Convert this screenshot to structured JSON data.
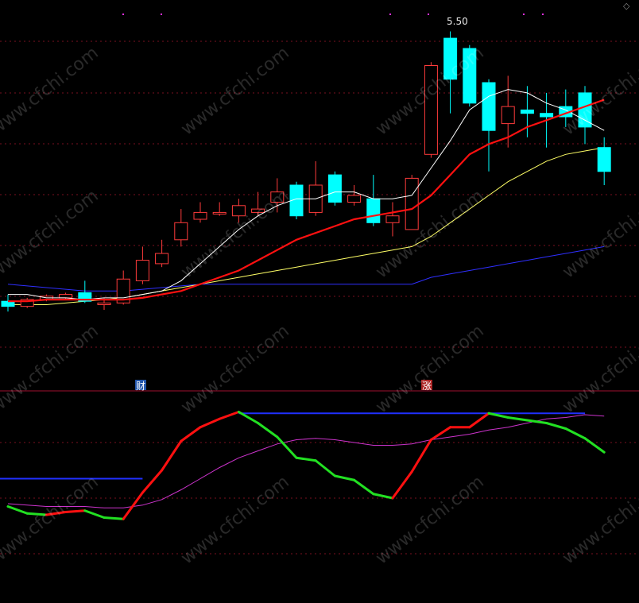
{
  "chart_data": [
    {
      "type": "candlestick",
      "panel": "price",
      "high_label": "5.50",
      "colors": {
        "up": "#ff3b3b",
        "down": "#00ffff",
        "ma5": "#ffffff",
        "ma10": "#ff1010",
        "ma20": "#ffff66",
        "ma60": "#2f2fff"
      },
      "candles": [
        {
          "o": 11,
          "c": 9.5,
          "h": 13,
          "l": 8
        },
        {
          "o": 9.5,
          "c": 11.5,
          "h": 12,
          "l": 9
        },
        {
          "o": 11.5,
          "c": 12.5,
          "h": 13,
          "l": 11
        },
        {
          "o": 12,
          "c": 13,
          "h": 13.5,
          "l": 11.5
        },
        {
          "o": 13.5,
          "c": 11,
          "h": 17,
          "l": 10.5
        },
        {
          "o": 10,
          "c": 10.5,
          "h": 12,
          "l": 8.5
        },
        {
          "o": 10.5,
          "c": 17.5,
          "h": 20,
          "l": 10
        },
        {
          "o": 17,
          "c": 23,
          "h": 27,
          "l": 16
        },
        {
          "o": 22,
          "c": 25,
          "h": 29,
          "l": 21
        },
        {
          "o": 29,
          "c": 34,
          "h": 38,
          "l": 27
        },
        {
          "o": 35,
          "c": 37,
          "h": 40,
          "l": 34
        },
        {
          "o": 37,
          "c": 37,
          "h": 40,
          "l": 36
        },
        {
          "o": 36,
          "c": 39,
          "h": 41,
          "l": 34
        },
        {
          "o": 37,
          "c": 38,
          "h": 43,
          "l": 36
        },
        {
          "o": 40,
          "c": 43,
          "h": 47,
          "l": 37
        },
        {
          "o": 45,
          "c": 36,
          "h": 46,
          "l": 35
        },
        {
          "o": 37,
          "c": 45,
          "h": 52,
          "l": 36
        },
        {
          "o": 48,
          "c": 40,
          "h": 49,
          "l": 39
        },
        {
          "o": 40,
          "c": 42,
          "h": 45,
          "l": 39
        },
        {
          "o": 41,
          "c": 34,
          "h": 48,
          "l": 33
        },
        {
          "o": 34,
          "c": 36,
          "h": 40,
          "l": 30
        },
        {
          "o": 32,
          "c": 47,
          "h": 48,
          "l": 32
        },
        {
          "o": 54,
          "c": 80,
          "h": 81,
          "l": 53
        },
        {
          "o": 88,
          "c": 76,
          "h": 90,
          "l": 66
        },
        {
          "o": 85,
          "c": 69,
          "h": 86,
          "l": 68
        },
        {
          "o": 75,
          "c": 61,
          "h": 76,
          "l": 49
        },
        {
          "o": 63,
          "c": 68,
          "h": 77,
          "l": 56
        },
        {
          "o": 67,
          "c": 66,
          "h": 74,
          "l": 59
        },
        {
          "o": 66,
          "c": 65,
          "h": 72,
          "l": 56
        },
        {
          "o": 68,
          "c": 65,
          "h": 73,
          "l": 62
        },
        {
          "o": 72,
          "c": 62,
          "h": 74,
          "l": 57
        },
        {
          "o": 56,
          "c": 49,
          "h": 59,
          "l": 45
        }
      ],
      "ma5": [
        13,
        13,
        12,
        12,
        11.5,
        12,
        12,
        13,
        14,
        17,
        22,
        27,
        32,
        36,
        39,
        41,
        41,
        43,
        43,
        41,
        41,
        42,
        50,
        58,
        67,
        71,
        73,
        72,
        69,
        67,
        64,
        61
      ],
      "ma10": [
        11,
        11,
        11.5,
        11.5,
        11.5,
        11.5,
        11.5,
        12,
        13,
        14,
        16,
        18,
        20,
        23,
        26,
        29,
        31,
        33,
        35,
        36,
        37,
        38,
        42,
        48,
        54,
        57,
        59,
        62,
        64,
        66,
        68,
        70
      ],
      "ma20": [
        10,
        10,
        10,
        10.5,
        11,
        11.5,
        12,
        13,
        14,
        15,
        16,
        17,
        18,
        19,
        20,
        21,
        22,
        23,
        24,
        25,
        26,
        27,
        30,
        34,
        38,
        42,
        46,
        49,
        52,
        54,
        55,
        56
      ],
      "ma60": [
        16,
        15.5,
        15,
        14.5,
        14,
        14,
        14,
        14.5,
        15,
        15.5,
        16,
        16,
        16,
        16,
        16,
        16,
        16,
        16,
        16,
        16,
        16,
        16,
        18,
        19,
        20,
        21,
        22,
        23,
        24,
        25,
        26,
        27
      ]
    },
    {
      "type": "line",
      "panel": "indicator",
      "colors": {
        "rising": "#ff1010",
        "falling": "#22e022",
        "signal": "#cc33cc",
        "level": "#2030ff"
      },
      "main": [
        20,
        15,
        14,
        16,
        17,
        12,
        11,
        30,
        46,
        67,
        77,
        83,
        88,
        80,
        70,
        55,
        53,
        42,
        39,
        29,
        26,
        45,
        68,
        77,
        77,
        87,
        84,
        82,
        80,
        76,
        69,
        59
      ],
      "signal": [
        22,
        21,
        20,
        20,
        20,
        19,
        19,
        21,
        25,
        32,
        40,
        48,
        55,
        60,
        65,
        68,
        69,
        68,
        66,
        64,
        64,
        65,
        68,
        70,
        72,
        75,
        77,
        80,
        83,
        84,
        86,
        85
      ],
      "level_segments": [
        {
          "from": 0,
          "to": 7,
          "value": 40
        },
        {
          "from": 12,
          "to": 30,
          "value": 87
        }
      ]
    }
  ],
  "markers": {
    "cai": {
      "text": "财",
      "bg": "#2255aa"
    },
    "zhang": {
      "text": "涨",
      "bg": "#aa2222"
    }
  },
  "watermark": "www.cfchi.com",
  "corner_glyph": "◇"
}
